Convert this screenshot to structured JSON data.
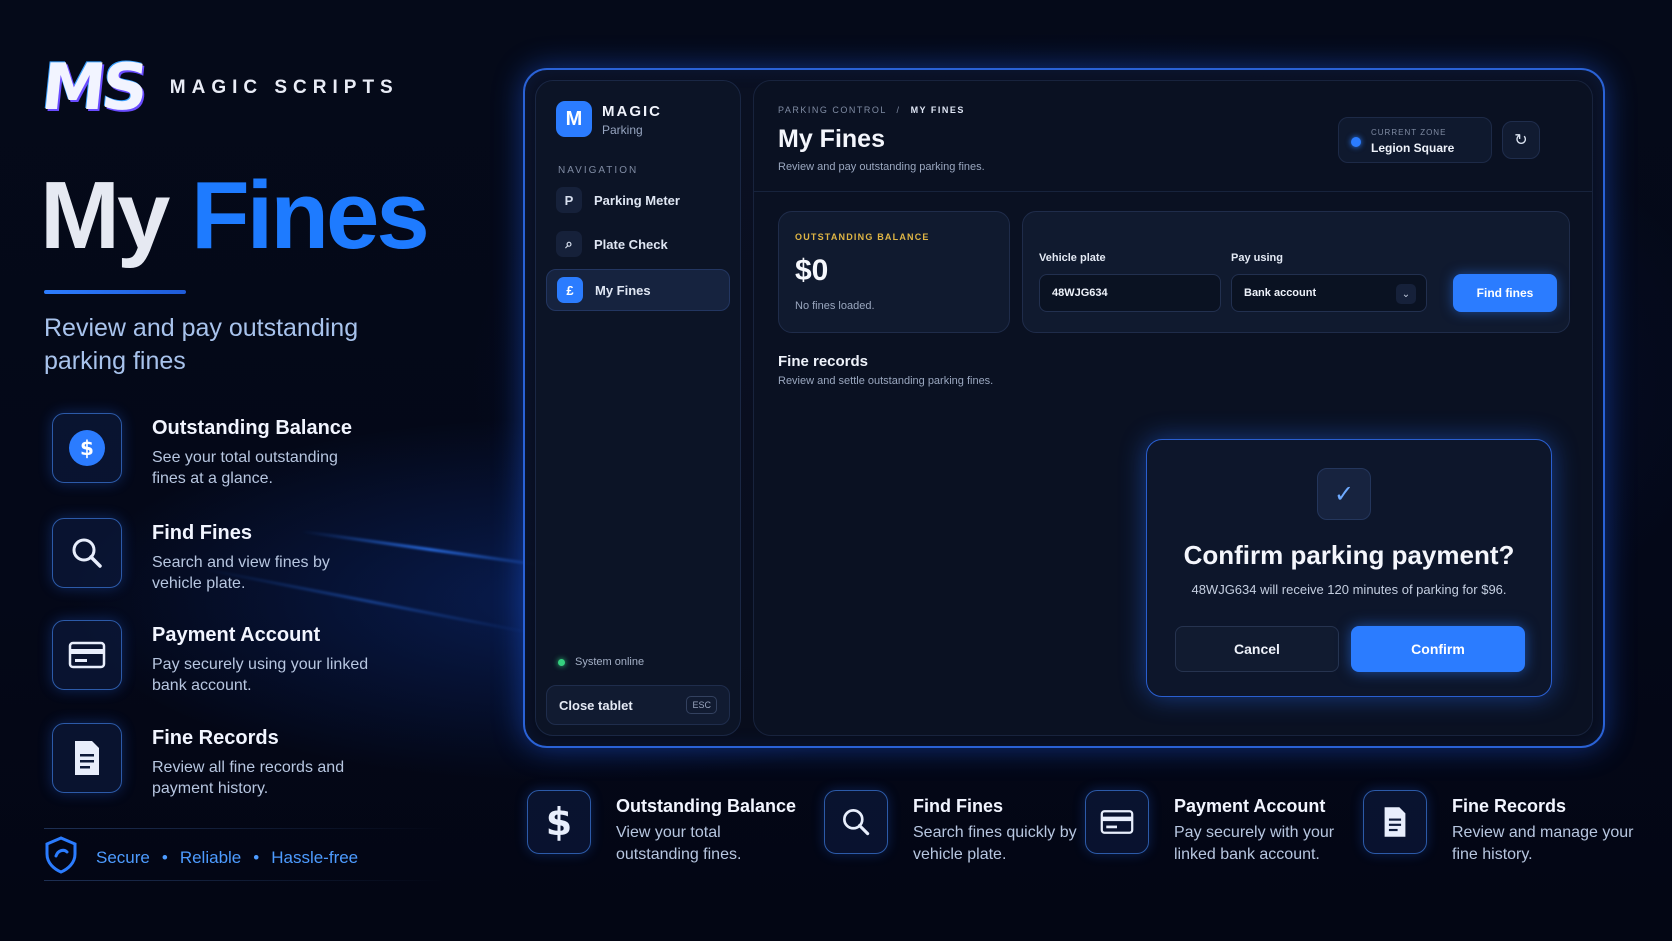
{
  "brand": {
    "logo": "MS",
    "name": "MAGIC SCRIPTS"
  },
  "hero": {
    "title_word1": "My",
    "title_word2": "Fines",
    "subtitle": "Review and pay outstanding parking fines"
  },
  "left_features": [
    {
      "title": "Outstanding Balance",
      "desc": "See your total outstanding fines at a glance.",
      "icon": "dollar-icon"
    },
    {
      "title": "Find Fines",
      "desc": "Search and view fines by vehicle plate.",
      "icon": "search-icon"
    },
    {
      "title": "Payment Account",
      "desc": "Pay securely using your linked bank account.",
      "icon": "card-icon"
    },
    {
      "title": "Fine Records",
      "desc": "Review all fine records and payment history.",
      "icon": "document-icon"
    }
  ],
  "trust": {
    "items": [
      "Secure",
      "Reliable",
      "Hassle-free"
    ],
    "icon": "shield-icon"
  },
  "tablet": {
    "sidebar": {
      "logo_letter": "M",
      "brand": "MAGIC",
      "sub": "Parking",
      "nav_label": "NAVIGATION",
      "items": [
        {
          "icon_text": "P",
          "label": "Parking Meter",
          "active": false
        },
        {
          "icon_text": "⌕",
          "label": "Plate Check",
          "active": false
        },
        {
          "icon_text": "£",
          "label": "My Fines",
          "active": true
        }
      ],
      "status": "System online",
      "close_label": "Close tablet",
      "close_key": "ESC"
    },
    "header": {
      "crumb_parent": "PARKING CONTROL",
      "crumb_sep": "/",
      "crumb_current": "MY FINES",
      "title": "My Fines",
      "subtitle": "Review and pay outstanding parking fines.",
      "zone_label": "CURRENT ZONE",
      "zone_value": "Legion Square",
      "refresh_icon": "↻"
    },
    "balance": {
      "label": "OUTSTANDING BALANCE",
      "value": "$0",
      "note": "No fines loaded."
    },
    "search": {
      "plate_label": "Vehicle plate",
      "plate_value": "48WJG634",
      "pay_label": "Pay using",
      "pay_value": "Bank account",
      "button": "Find fines"
    },
    "records": {
      "title": "Fine records",
      "subtitle": "Review and settle outstanding parking fines."
    },
    "modal": {
      "check": "✓",
      "title": "Confirm parking payment?",
      "message": "48WJG634 will receive 120 minutes of parking for $96.",
      "cancel": "Cancel",
      "confirm": "Confirm"
    }
  },
  "bottom_features": [
    {
      "title": "Outstanding Balance",
      "desc": "View your total outstanding fines.",
      "icon": "dollar-icon"
    },
    {
      "title": "Find Fines",
      "desc": "Search fines quickly by vehicle plate.",
      "icon": "search-icon"
    },
    {
      "title": "Payment Account",
      "desc": "Pay securely with your linked bank account.",
      "icon": "card-icon"
    },
    {
      "title": "Fine Records",
      "desc": "Review and manage your fine history.",
      "icon": "document-icon"
    }
  ],
  "colors": {
    "accent": "#2b7cff",
    "balance_label": "#e0b645",
    "online": "#35d07f"
  }
}
